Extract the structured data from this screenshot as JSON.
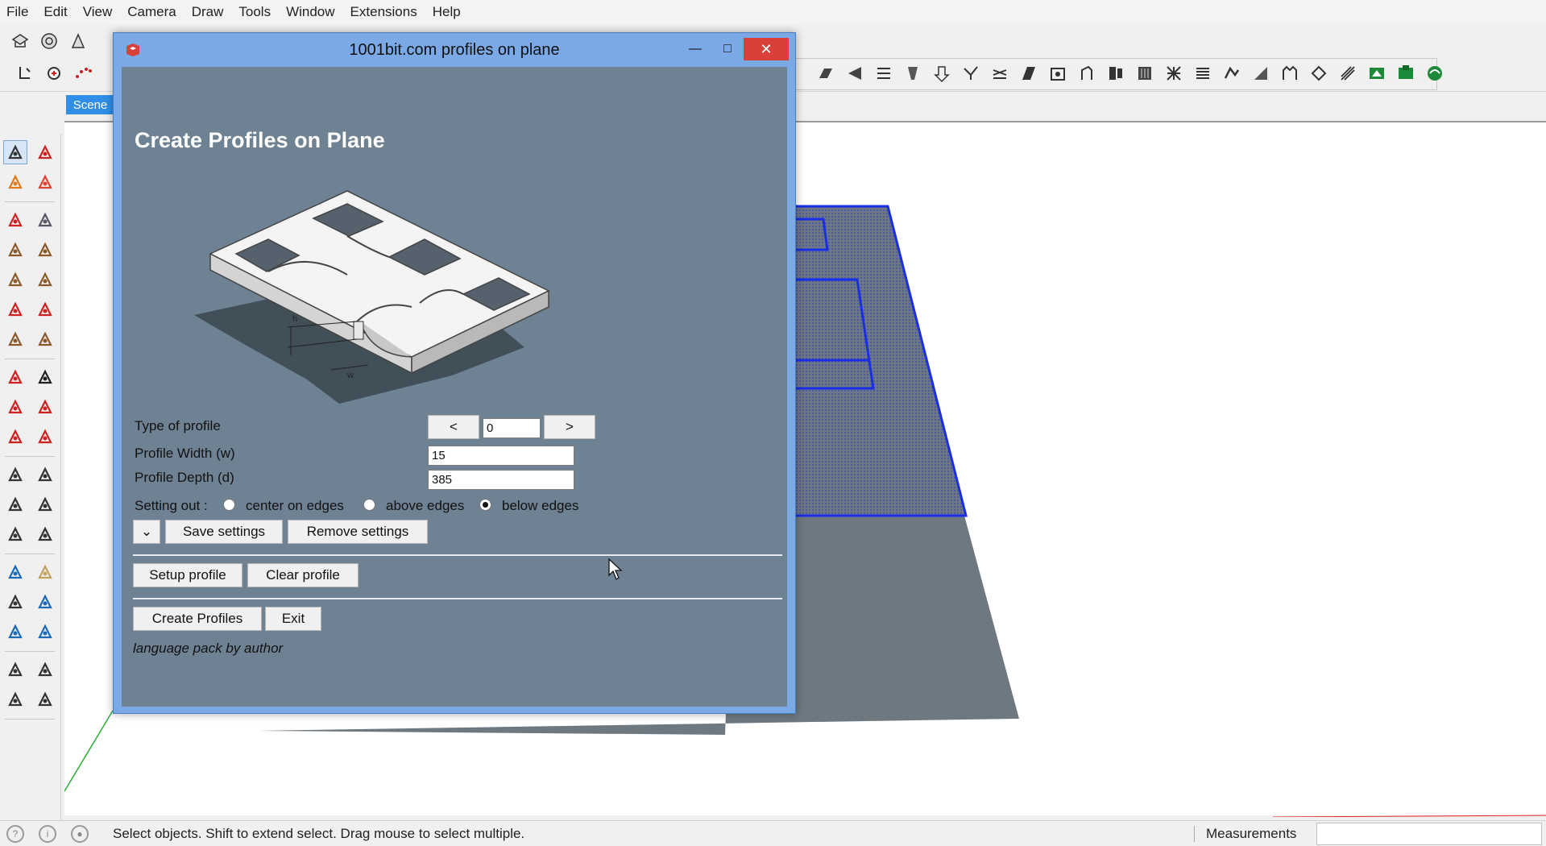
{
  "menu": [
    "File",
    "Edit",
    "View",
    "Camera",
    "Draw",
    "Tools",
    "Window",
    "Extensions",
    "Help"
  ],
  "scene_tab": "Scene",
  "dialog": {
    "title": "1001bit.com profiles on plane",
    "heading": "Create Profiles on Plane",
    "type_label": "Type of profile",
    "prev_label": "<",
    "next_label": ">",
    "type_value": "0",
    "width_label": "Profile Width (w)",
    "width_value": "15",
    "depth_label": "Profile Depth (d)",
    "depth_value": "385",
    "settingout_label": "Setting out :",
    "options": [
      "center on edges",
      "above edges",
      "below edges"
    ],
    "selected_option": "below edges",
    "save_label": "Save settings",
    "remove_label": "Remove settings",
    "setup_label": "Setup profile",
    "clear_label": "Clear profile",
    "create_label": "Create Profiles",
    "exit_label": "Exit",
    "note": "language pack by author",
    "close_glyph": "✕",
    "min_glyph": "—",
    "max_glyph": "□",
    "dropdown_glyph": "⌄"
  },
  "illustration": {
    "h_label": "h",
    "w_label": "w"
  },
  "status": {
    "message": "Select objects. Shift to extend select. Drag mouse to select multiple.",
    "measurements_label": "Measurements"
  },
  "icons": {
    "top_row1": [
      "get-models-icon",
      "3d-warehouse-icon",
      "extension-warehouse-icon",
      "layout-icon"
    ],
    "top_row2": [
      "move-plugin-icon",
      "rotate-plugin-icon",
      "arc-dots-icon",
      "pin-icon"
    ],
    "right_toolbar": [
      "stair-icon",
      "roof-icon",
      "frame-icon",
      "column-icon",
      "beam-icon",
      "rafter-icon",
      "joist-icon",
      "panel-icon",
      "truss-icon",
      "door-icon",
      "window-icon",
      "louvre-icon",
      "grid-icon",
      "shutter-icon",
      "staircase-icon",
      "railing-icon",
      "fence-icon",
      "spiral-icon",
      "wall-icon",
      "opening-icon",
      "layer-icon",
      "group-icon",
      "component-icon"
    ],
    "left": [
      "select-icon",
      "make-component-icon",
      "paint-bucket-icon",
      "eraser-icon",
      "pencil-icon",
      "freehand-icon",
      "rectangle-icon",
      "rotated-rectangle-icon",
      "circle-icon",
      "polygon-icon",
      "arc-icon",
      "pie-icon",
      "two-point-arc-icon",
      "three-point-arc-icon",
      "move-icon",
      "push-pull-icon",
      "rotate-icon",
      "follow-me-icon",
      "scale-icon",
      "offset-icon",
      "tape-measure-icon",
      "dimension-icon",
      "protractor-icon",
      "text-icon",
      "axes-icon",
      "3d-text-icon",
      "orbit-icon",
      "pan-icon",
      "zoom-icon",
      "zoom-window-icon",
      "zoom-extents-icon",
      "previous-view-icon",
      "position-camera-icon",
      "look-around-icon",
      "walk-icon",
      "section-plane-icon"
    ]
  },
  "colors": {
    "dialog_bg": "#6e8293",
    "dialog_frame": "#7aa9e6",
    "close_red": "#d9403a",
    "plane_blue": "#1a2ee6",
    "plane_gray": "#6e7880",
    "scene_tab": "#2f8fe6"
  }
}
